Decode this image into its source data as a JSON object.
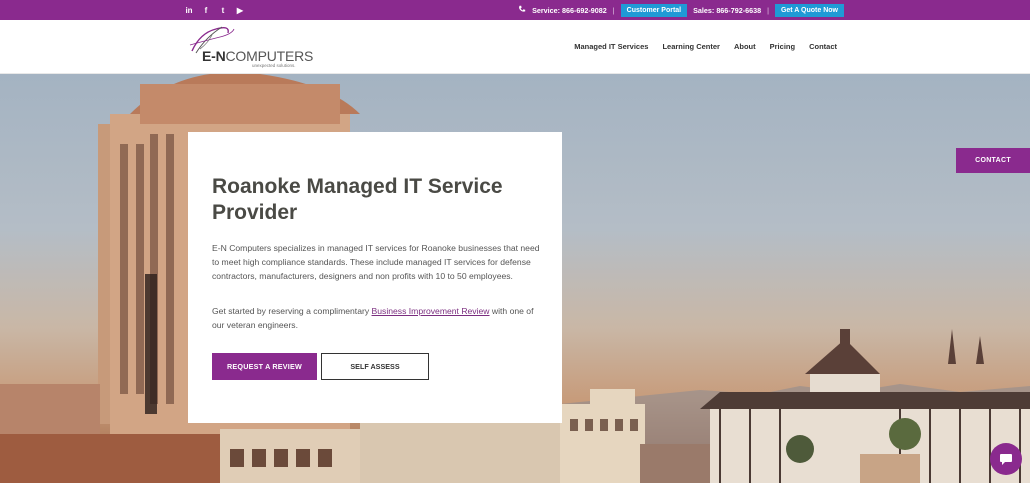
{
  "topbar": {
    "social": [
      {
        "icon": "linkedin-icon",
        "glyph": "in"
      },
      {
        "icon": "facebook-icon",
        "glyph": "f"
      },
      {
        "icon": "twitter-icon",
        "glyph": "t"
      },
      {
        "icon": "youtube-icon",
        "glyph": "▶"
      }
    ],
    "service": "Service: 866-692-9082",
    "customer_portal": "Customer Portal",
    "sales": "Sales: 866-792-6638",
    "quote": "Get A Quote Now",
    "separator": "|"
  },
  "header": {
    "logo_brand_bold": "E-N",
    "logo_brand_rest": "COMPUTERS",
    "logo_tagline": "unexpected solutions.",
    "nav": [
      "Managed IT Services",
      "Learning Center",
      "About",
      "Pricing",
      "Contact"
    ]
  },
  "hero": {
    "title": "Roanoke Managed IT Service Provider",
    "paragraph1": "E-N Computers specializes in managed IT services for Roanoke businesses that need to meet high compliance standards. These include managed IT services for defense contractors, manufacturers, designers and non profits with 10 to 50 employees.",
    "paragraph2_before": "Get started by reserving a complimentary ",
    "paragraph2_link": "Business Improvement Review",
    "paragraph2_after": " with one of our veteran engineers.",
    "primary_button": "REQUEST A REVIEW",
    "secondary_button": "SELF ASSESS"
  },
  "floating": {
    "contact_tab": "CONTACT",
    "chat_icon": "chat-bubble-icon"
  },
  "colors": {
    "brand_purple": "#8a2a8e",
    "portal_blue": "#1f9ad6"
  }
}
